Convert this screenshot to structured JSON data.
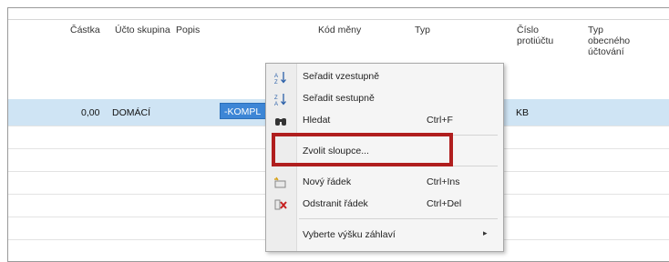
{
  "columns": {
    "castka": "Částka",
    "ucto_skupina": "Účto skupina",
    "popis": "Popis",
    "kod_meny": "Kód měny",
    "typ": "Typ",
    "cislo_protiuctu": [
      "Číslo",
      "protiúčtu"
    ],
    "typ_obecneho": [
      "Typ",
      "obecného",
      "účtování"
    ]
  },
  "row": {
    "castka": "0,00",
    "ucto_skupina": "DOMÁCÍ",
    "popis": "-KOMPL",
    "cislo_protiuctu": "KB"
  },
  "menu": {
    "items": [
      {
        "label": "Seřadit vzestupně",
        "shortcut": "",
        "icon": "sort-ascending-icon"
      },
      {
        "label": "Seřadit sestupně",
        "shortcut": "",
        "icon": "sort-descending-icon"
      },
      {
        "label": "Hledat",
        "shortcut": "Ctrl+F",
        "icon": "binoculars-icon"
      },
      {
        "label": "Zvolit sloupce...",
        "shortcut": "",
        "icon": ""
      },
      {
        "label": "Nový řádek",
        "shortcut": "Ctrl+Ins",
        "icon": "new-row-icon"
      },
      {
        "label": "Odstranit řádek",
        "shortcut": "Ctrl+Del",
        "icon": "delete-row-icon"
      },
      {
        "label": "Vyberte výšku záhlaví",
        "shortcut": "",
        "icon": "submenu-arrow-icon"
      }
    ]
  },
  "colors": {
    "selected_row": "#cfe4f4",
    "selected_cell": "#3d86d6",
    "highlight_box": "#b01e1e"
  }
}
